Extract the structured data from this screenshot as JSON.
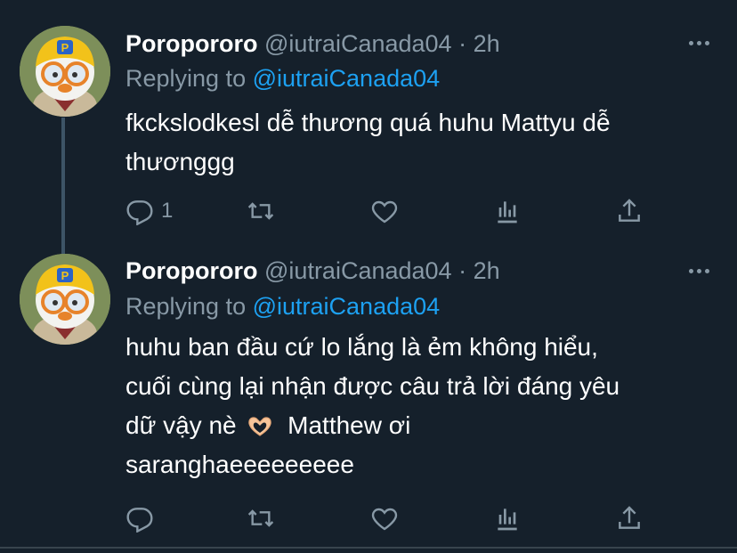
{
  "tweets": [
    {
      "name": "Poropororo",
      "handle": "@iutraiCanada04",
      "separator": "·",
      "time": "2h",
      "replying_prefix": "Replying to",
      "replying_to": "@iutraiCanada04",
      "body_lines": [
        "fkckslodkesl dễ thương quá huhu Mattyu dễ",
        "thươnggg"
      ],
      "reply_count": "1"
    },
    {
      "name": "Poropororo",
      "handle": "@iutraiCanada04",
      "separator": "·",
      "time": "2h",
      "replying_prefix": "Replying to",
      "replying_to": "@iutraiCanada04",
      "body_lines": [
        "huhu ban đầu cứ lo lắng là ẻm không hiểu,",
        "cuối cùng lại nhận được câu trả lời đáng yêu",
        "dữ vậy nè",
        "Matthew ơi",
        "saranghaeeeeeeeee"
      ],
      "reply_count": ""
    }
  ],
  "icons": {
    "reply": "reply-icon",
    "retweet": "retweet-icon",
    "like": "heart-icon",
    "analytics": "analytics-icon",
    "share": "share-icon",
    "more": "more-icon",
    "emoji": "heart-hands-emoji"
  },
  "colors": {
    "background": "#15202b",
    "text": "#ffffff",
    "secondary": "#8899a6",
    "link": "#1da1f2"
  }
}
